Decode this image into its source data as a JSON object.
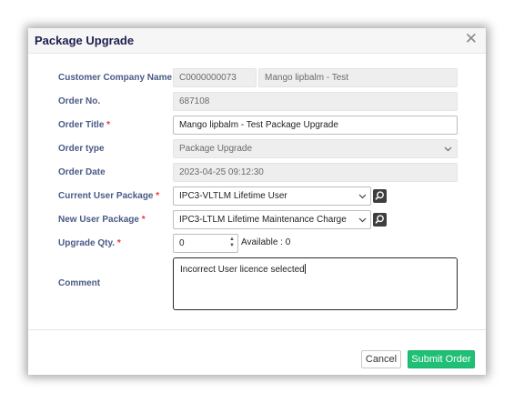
{
  "dialog": {
    "title": "Package Upgrade",
    "close_icon": "close-icon"
  },
  "form": {
    "customer_company_name": {
      "label": "Customer Company Name",
      "code": "C0000000073",
      "name": "Mango lipbalm - Test"
    },
    "order_no": {
      "label": "Order No.",
      "value": "687108"
    },
    "order_title": {
      "label": "Order Title",
      "required_mark": "*",
      "value": "Mango lipbalm - Test Package Upgrade"
    },
    "order_type": {
      "label": "Order type",
      "value": "Package Upgrade",
      "icon": "chevron-down-icon"
    },
    "order_date": {
      "label": "Order Date",
      "value": "2023-04-25 09:12:30"
    },
    "current_user_package": {
      "label": "Current User Package",
      "required_mark": "*",
      "value": "IPC3-VLTLM Lifetime User",
      "icon": "search-icon"
    },
    "new_user_package": {
      "label": "New User Package",
      "required_mark": "*",
      "value": "IPC3-LTLM Lifetime Maintenance Charge",
      "icon": "search-icon"
    },
    "upgrade_qty": {
      "label": "Upgrade Qty.",
      "required_mark": "*",
      "value": "0",
      "available_text": "Available : 0"
    },
    "comment": {
      "label": "Comment",
      "value": "Incorrect User licence selected"
    }
  },
  "footer": {
    "cancel_label": "Cancel",
    "submit_label": "Submit Order",
    "submit_color": "#1fbf75"
  }
}
